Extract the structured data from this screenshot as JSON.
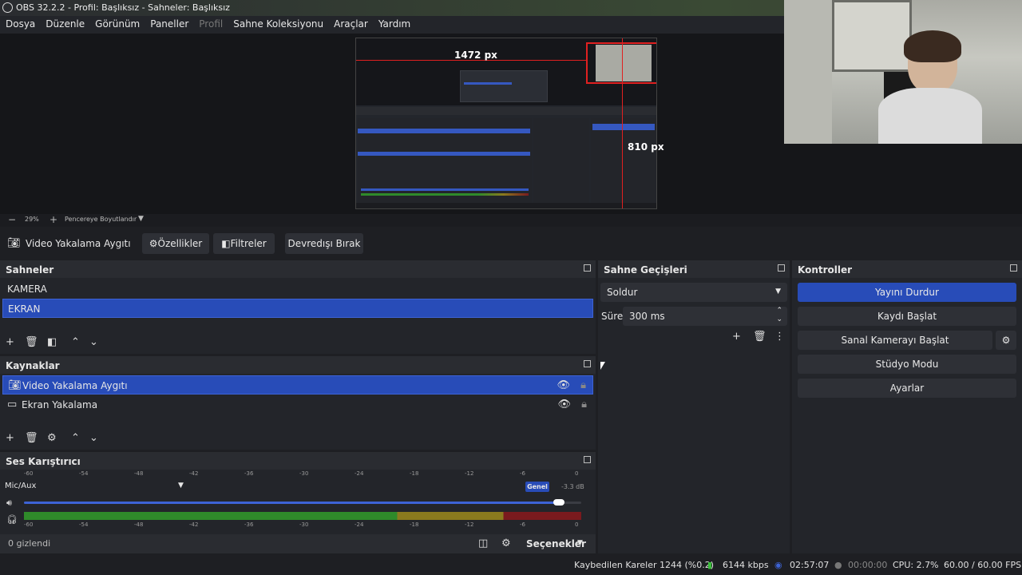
{
  "window": {
    "title": "OBS 32.2.2 - Profil: Başlıksız - Sahneler: Başlıksız"
  },
  "menu": [
    "Dosya",
    "Düzenle",
    "Görünüm",
    "Paneller",
    "Profil",
    "Sahne Koleksiyonu",
    "Araçlar",
    "Yardım"
  ],
  "preview": {
    "width_label": "1472 px",
    "height_label": "810 px"
  },
  "zoom": {
    "minus": "−",
    "value": "29%",
    "plus": "+",
    "fit": "Pencereye Boyutlandır"
  },
  "source_toolbar": {
    "selected_source": "Video Yakalama Aygıtı",
    "properties": "Özellikler",
    "filters": "Filtreler",
    "deactivate": "Devredışı Bırak"
  },
  "scenes": {
    "title": "Sahneler",
    "items": [
      "KAMERA",
      "EKRAN"
    ],
    "selected": "EKRAN"
  },
  "sources": {
    "title": "Kaynaklar",
    "items": [
      "Video Yakalama Aygıtı",
      "Ekran Yakalama"
    ]
  },
  "transitions": {
    "title": "Sahne Geçişleri",
    "type": "Soldur",
    "duration_label": "Süre",
    "duration": "300 ms"
  },
  "controls": {
    "title": "Kontroller",
    "stop_stream": "Yayını Durdur",
    "start_record": "Kaydı Başlat",
    "start_virtualcam": "Sanal Kamerayı Başlat",
    "studio_mode": "Stüdyo Modu",
    "settings": "Ayarlar"
  },
  "mixer": {
    "title": "Ses Karıştırıcı",
    "channel": "Mic/Aux",
    "badge": "Genel",
    "db": "-3.3 dB",
    "scale": [
      "-60",
      "-54",
      "-48",
      "-42",
      "-36",
      "-30",
      "-24",
      "-18",
      "-12",
      "-6",
      "0"
    ],
    "volume_fraction": 0.98,
    "hidden": "0 gizlendi",
    "options": "Seçenekler"
  },
  "status": {
    "dropped": "Kaybedilen Kareler 1244 (%0.2)",
    "bitrate": "6144 kbps",
    "stream_time": "02:57:07",
    "rec_time": "00:00:00",
    "cpu": "CPU: 2.7%",
    "fps": "60.00 / 60.00 FPS"
  },
  "colors": {
    "accent": "#284cb8",
    "panel": "#23252a",
    "meter_green": "#2f8a2a",
    "meter_yellow": "#8a7a1e",
    "meter_red": "#7a1a1e"
  }
}
